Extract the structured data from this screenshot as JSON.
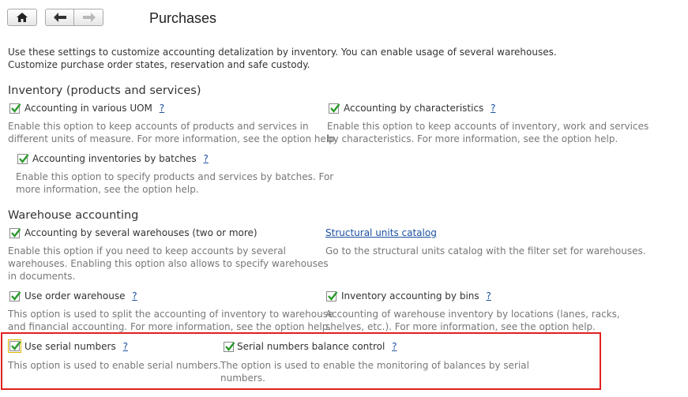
{
  "header": {
    "title": "Purchases"
  },
  "intro": {
    "line1": "Use these settings to customize accounting detalization by inventory. You can enable usage of several warehouses.",
    "line2": "Customize purchase order states, reservation and safe custody."
  },
  "help_mark": "?",
  "inventory": {
    "heading": "Inventory (products and services)",
    "uom": {
      "label": "Accounting in various UOM",
      "checked": true,
      "desc1": "Enable this option to keep accounts of products and services in",
      "desc2": "different units of measure. For more information, see the option help."
    },
    "characteristics": {
      "label": "Accounting by characteristics",
      "checked": true,
      "desc1": "Enable this option to keep accounts of inventory, work and services",
      "desc2": "by characteristics. For more information, see the option help."
    },
    "batches": {
      "label": "Accounting inventories by batches",
      "checked": true,
      "desc1": "Enable this option to specify products and services by batches. For",
      "desc2": "more information, see the option help."
    }
  },
  "warehouse": {
    "heading": "Warehouse accounting",
    "several": {
      "label": "Accounting by several warehouses (two or more)",
      "checked": true,
      "desc1": "Enable this option if you need to keep accounts by several",
      "desc2": "warehouses. Enabling this option also allows to specify warehouses",
      "desc3": "in documents."
    },
    "structural": {
      "link": "Structural units catalog",
      "desc": "Go to the structural units catalog with the filter set for warehouses."
    },
    "order": {
      "label": "Use order warehouse",
      "checked": true,
      "desc1": "This option is used to split the accounting of inventory to warehouse",
      "desc2": "and financial accounting. For more information, see the option help."
    },
    "bins": {
      "label": "Inventory accounting by bins",
      "checked": true,
      "desc1": "Accounting of warehouse inventory by locations (lanes, racks,",
      "desc2": "shelves, etc.). For more information, see the option help."
    },
    "serial": {
      "label": "Use serial numbers",
      "checked": true,
      "desc": "This option is used to enable serial numbers."
    },
    "serial_balance": {
      "label": "Serial numbers balance control",
      "checked": true,
      "desc1": "The option is used to enable the monitoring of balances by serial",
      "desc2": "numbers."
    }
  },
  "colors": {
    "link": "#1a4fa0",
    "check": "#2a9a2a",
    "highlight": "#e02020"
  }
}
